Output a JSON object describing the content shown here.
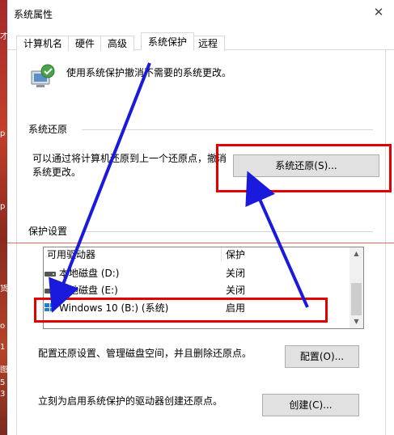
{
  "window": {
    "title": "系统属性",
    "close_glyph": "✕"
  },
  "tabs": [
    {
      "label": "计算机名"
    },
    {
      "label": "硬件"
    },
    {
      "label": "高级"
    },
    {
      "label": "系统保护",
      "active": true
    },
    {
      "label": "远程"
    }
  ],
  "intro": {
    "text": "使用系统保护撤消不需要的系统更改。"
  },
  "system_restore": {
    "heading": "系统还原",
    "description_line1": "可以通过将计算机还原到上一个还原点，撤消",
    "description_line2": "系统更改。",
    "button_label": "系统还原(S)..."
  },
  "protection": {
    "heading": "保护设置",
    "columns": {
      "drive": "可用驱动器",
      "status": "保护"
    },
    "rows": [
      {
        "drive": "本地磁盘 (D:)",
        "status": "关闭",
        "icon": "drive-icon"
      },
      {
        "drive": "本地磁盘 (E:)",
        "status": "关闭",
        "icon": "drive-icon"
      },
      {
        "drive": "Windows 10 (B:) (系统)",
        "status": "启用",
        "icon": "windows-drive-icon"
      }
    ],
    "configure_text": "配置还原设置、管理磁盘空间，并且删除还原点。",
    "configure_button": "配置(O)...",
    "create_text": "立刻为启用系统保护的驱动器创建还原点。",
    "create_button": "创建(C)..."
  },
  "desktop_strip": {
    "glyphs": [
      "才",
      "p",
      "p",
      "货",
      "o",
      "1",
      "图",
      "5",
      "3"
    ]
  },
  "colors": {
    "annotation_red": "#e30000",
    "annotation_arrow": "#1a1adc"
  }
}
